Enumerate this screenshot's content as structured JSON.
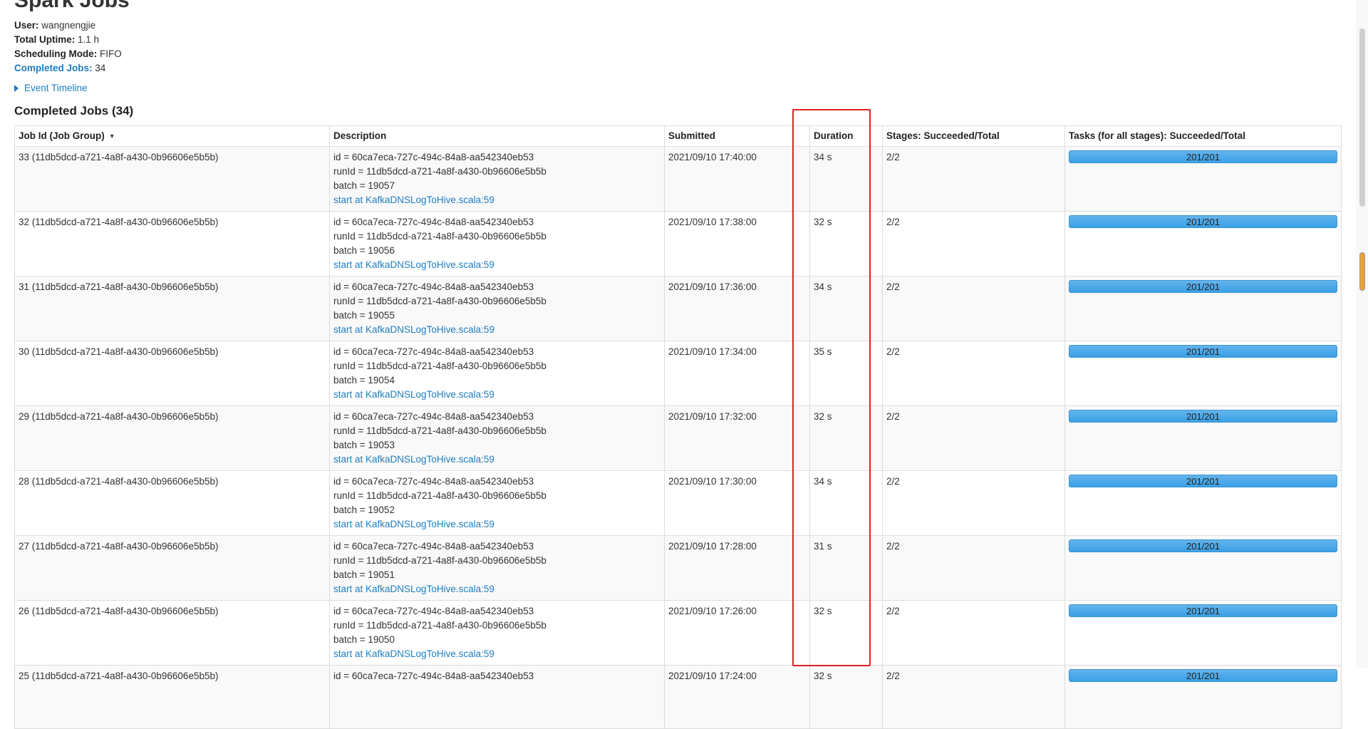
{
  "page": {
    "title": "Spark Jobs"
  },
  "summary": {
    "user_label": "User:",
    "user_value": "wangnengjie",
    "uptime_label": "Total Uptime:",
    "uptime_value": "1.1 h",
    "scheduling_label": "Scheduling Mode:",
    "scheduling_value": "FIFO",
    "completed_label": "Completed Jobs:",
    "completed_value": "34"
  },
  "timeline": {
    "label": "Event Timeline"
  },
  "completed_section": {
    "title": "Completed Jobs (34)"
  },
  "table": {
    "headers": {
      "job_id": "Job Id (Job Group)",
      "description": "Description",
      "submitted": "Submitted",
      "duration": "Duration",
      "stages": "Stages: Succeeded/Total",
      "tasks": "Tasks (for all stages): Succeeded/Total"
    },
    "rows": [
      {
        "job": "33 (11db5dcd-a721-4a8f-a430-0b96606e5b5b)",
        "id_line": "id = 60ca7eca-727c-494c-84a8-aa542340eb53",
        "runid_line": "runId = 11db5dcd-a721-4a8f-a430-0b96606e5b5b",
        "batch_line": "batch = 19057",
        "link": "start at KafkaDNSLogToHive.scala:59",
        "submitted": "2021/09/10 17:40:00",
        "duration": "34 s",
        "stages": "2/2",
        "tasks": "201/201",
        "task_fraction": 1.0
      },
      {
        "job": "32 (11db5dcd-a721-4a8f-a430-0b96606e5b5b)",
        "id_line": "id = 60ca7eca-727c-494c-84a8-aa542340eb53",
        "runid_line": "runId = 11db5dcd-a721-4a8f-a430-0b96606e5b5b",
        "batch_line": "batch = 19056",
        "link": "start at KafkaDNSLogToHive.scala:59",
        "submitted": "2021/09/10 17:38:00",
        "duration": "32 s",
        "stages": "2/2",
        "tasks": "201/201",
        "task_fraction": 1.0
      },
      {
        "job": "31 (11db5dcd-a721-4a8f-a430-0b96606e5b5b)",
        "id_line": "id = 60ca7eca-727c-494c-84a8-aa542340eb53",
        "runid_line": "runId = 11db5dcd-a721-4a8f-a430-0b96606e5b5b",
        "batch_line": "batch = 19055",
        "link": "start at KafkaDNSLogToHive.scala:59",
        "submitted": "2021/09/10 17:36:00",
        "duration": "34 s",
        "stages": "2/2",
        "tasks": "201/201",
        "task_fraction": 1.0
      },
      {
        "job": "30 (11db5dcd-a721-4a8f-a430-0b96606e5b5b)",
        "id_line": "id = 60ca7eca-727c-494c-84a8-aa542340eb53",
        "runid_line": "runId = 11db5dcd-a721-4a8f-a430-0b96606e5b5b",
        "batch_line": "batch = 19054",
        "link": "start at KafkaDNSLogToHive.scala:59",
        "submitted": "2021/09/10 17:34:00",
        "duration": "35 s",
        "stages": "2/2",
        "tasks": "201/201",
        "task_fraction": 1.0
      },
      {
        "job": "29 (11db5dcd-a721-4a8f-a430-0b96606e5b5b)",
        "id_line": "id = 60ca7eca-727c-494c-84a8-aa542340eb53",
        "runid_line": "runId = 11db5dcd-a721-4a8f-a430-0b96606e5b5b",
        "batch_line": "batch = 19053",
        "link": "start at KafkaDNSLogToHive.scala:59",
        "submitted": "2021/09/10 17:32:00",
        "duration": "32 s",
        "stages": "2/2",
        "tasks": "201/201",
        "task_fraction": 1.0
      },
      {
        "job": "28 (11db5dcd-a721-4a8f-a430-0b96606e5b5b)",
        "id_line": "id = 60ca7eca-727c-494c-84a8-aa542340eb53",
        "runid_line": "runId = 11db5dcd-a721-4a8f-a430-0b96606e5b5b",
        "batch_line": "batch = 19052",
        "link": "start at KafkaDNSLogToHive.scala:59",
        "submitted": "2021/09/10 17:30:00",
        "duration": "34 s",
        "stages": "2/2",
        "tasks": "201/201",
        "task_fraction": 1.0
      },
      {
        "job": "27 (11db5dcd-a721-4a8f-a430-0b96606e5b5b)",
        "id_line": "id = 60ca7eca-727c-494c-84a8-aa542340eb53",
        "runid_line": "runId = 11db5dcd-a721-4a8f-a430-0b96606e5b5b",
        "batch_line": "batch = 19051",
        "link": "start at KafkaDNSLogToHive.scala:59",
        "submitted": "2021/09/10 17:28:00",
        "duration": "31 s",
        "stages": "2/2",
        "tasks": "201/201",
        "task_fraction": 1.0
      },
      {
        "job": "26 (11db5dcd-a721-4a8f-a430-0b96606e5b5b)",
        "id_line": "id = 60ca7eca-727c-494c-84a8-aa542340eb53",
        "runid_line": "runId = 11db5dcd-a721-4a8f-a430-0b96606e5b5b",
        "batch_line": "batch = 19050",
        "link": "start at KafkaDNSLogToHive.scala:59",
        "submitted": "2021/09/10 17:26:00",
        "duration": "32 s",
        "stages": "2/2",
        "tasks": "201/201",
        "task_fraction": 1.0
      },
      {
        "job": "25 (11db5dcd-a721-4a8f-a430-0b96606e5b5b)",
        "id_line": "id = 60ca7eca-727c-494c-84a8-aa542340eb53",
        "runid_line": "",
        "batch_line": "",
        "link": "",
        "submitted": "2021/09/10 17:24:00",
        "duration": "32 s",
        "stages": "2/2",
        "tasks": "201/201",
        "task_fraction": 1.0
      }
    ]
  },
  "annotation": {
    "color": "#e02020"
  }
}
